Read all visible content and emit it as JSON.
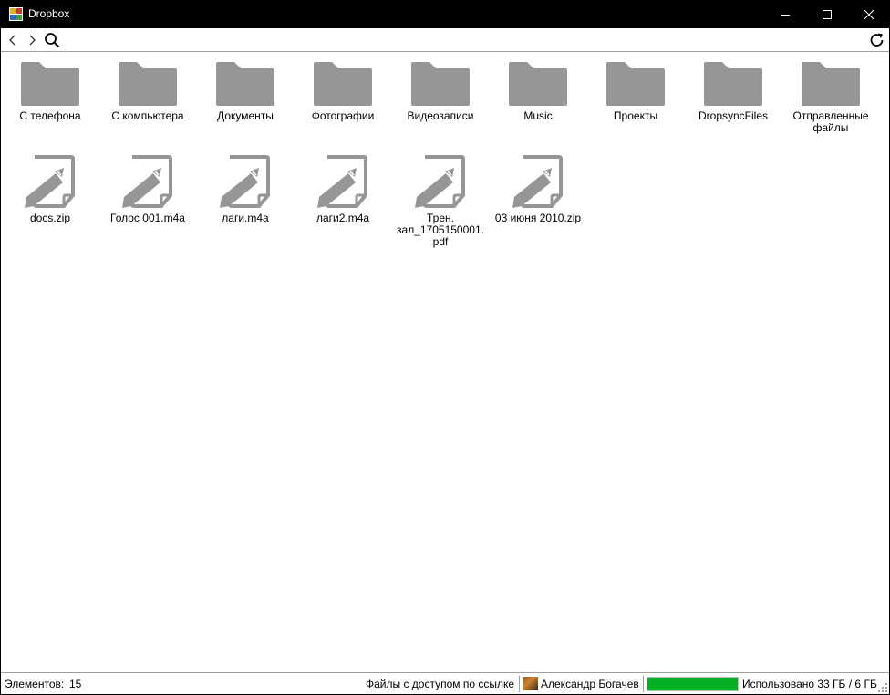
{
  "window": {
    "title": "Dropbox"
  },
  "toolbar": {
    "back_icon": "chevron-left-icon",
    "forward_icon": "chevron-right-icon",
    "search_icon": "search-icon",
    "refresh_icon": "refresh-icon"
  },
  "folders": [
    {
      "label": "С телефона"
    },
    {
      "label": "С компьютера"
    },
    {
      "label": "Документы"
    },
    {
      "label": "Фотографии"
    },
    {
      "label": "Видеозаписи"
    },
    {
      "label": "Music"
    },
    {
      "label": "Проекты"
    },
    {
      "label": "DropsyncFiles"
    },
    {
      "label": "Отправленные файлы"
    }
  ],
  "files": [
    {
      "label": "docs.zip"
    },
    {
      "label": "Голос 001.m4a"
    },
    {
      "label": "лаги.m4a"
    },
    {
      "label": "лаги2.m4a"
    },
    {
      "label": "Трен. зал_1705150001.pdf"
    },
    {
      "label": "03 июня 2010.zip"
    }
  ],
  "status": {
    "items_label": "Элементов:",
    "items_count": "15",
    "shared_link": "Файлы с доступом по ссылке",
    "user_name": "Александр Богачев",
    "usage_text": "Использовано 33 ГБ / 6 ГБ",
    "usage_fraction": 1.0
  },
  "colors": {
    "folder": "#969696",
    "progress": "#06b025",
    "titlebar": "#000000"
  }
}
